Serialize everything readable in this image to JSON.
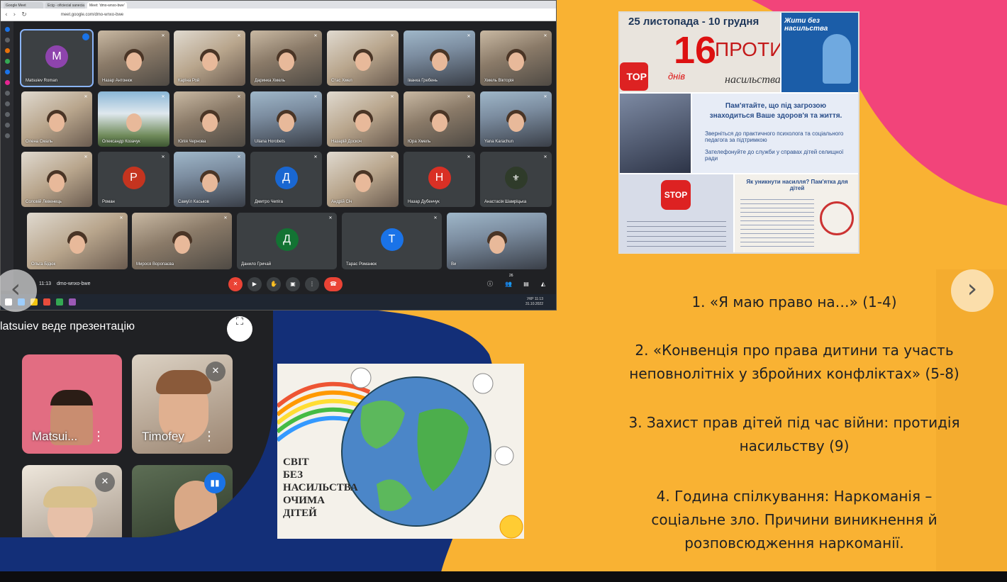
{
  "colors": {
    "orange": "#f9b233",
    "pink": "#f2447a",
    "navy": "#132f78",
    "dark": "#202124"
  },
  "browser": {
    "tabs": [
      "Google Meet",
      "Ecig - oficiecial sanecia Gr",
      "Meet: 'dmo-wnxo-bwe'"
    ],
    "url": "meet.google.com/dmo-wnxo-bwe"
  },
  "meet": {
    "participants": [
      {
        "name": "Matsuiev Roman",
        "initial": "M",
        "avatar_color": "#8e44ad"
      },
      {
        "name": "Назар Антонюк"
      },
      {
        "name": "Каріна Рой"
      },
      {
        "name": "Даринка Хмель"
      },
      {
        "name": "Стас Хмел"
      },
      {
        "name": "Іванка Гребень"
      },
      {
        "name": "Хмель Вікторія"
      },
      {
        "name": "Олена Смаль"
      },
      {
        "name": "Олександр Козачук"
      },
      {
        "name": "Юлія Чернова"
      },
      {
        "name": "Uliana Horobets"
      },
      {
        "name": "Назарій Доскоч"
      },
      {
        "name": "Юра Хмель"
      },
      {
        "name": "Yana Karachun"
      },
      {
        "name": "Соловій Левенець"
      },
      {
        "name": "Роман",
        "initial": "Р",
        "avatar_color": "#c5341f"
      },
      {
        "name": "Самуїл Каськов"
      },
      {
        "name": "Дмитро Чепіга",
        "initial": "Д",
        "avatar_color": "#1967d2"
      },
      {
        "name": "Андрій Січ"
      },
      {
        "name": "Назар Дубенчук",
        "initial": "Н",
        "avatar_color": "#d93025"
      },
      {
        "name": "Анастасія Шамріцька"
      },
      {
        "name": "Ольга Бідюк"
      },
      {
        "name": "Мирося Воропаєва"
      },
      {
        "name": "Данило Гричай",
        "initial": "Д",
        "avatar_color": "#137333"
      },
      {
        "name": "Тарас Романюк",
        "initial": "Т",
        "avatar_color": "#1a73e8"
      },
      {
        "name": "Ви"
      }
    ],
    "time": "11:13",
    "meeting_code": "dmo-wnxo-bwe",
    "participant_count": "26",
    "tray": {
      "lang": "УКР",
      "clock": "11:13",
      "date": "31.10.2022"
    }
  },
  "phone": {
    "header": "latsuiev веде презентацію",
    "tiles": [
      {
        "name": "Matsui..."
      },
      {
        "name": "Timofey"
      }
    ]
  },
  "collage": {
    "date_range": "25 листопада - 10 грудня",
    "big_number": "16",
    "title_line1": "ПРОТИ",
    "title_line2": "насильства",
    "days": "днів",
    "stop": "TOP",
    "side_title": "Жити без насильства",
    "memo_line1": "Пам'ятайте, що під загрозою",
    "memo_line2": "знаходиться Ваше здоров'я та життя.",
    "memo_b1": "Зверніться до практичного психолога та соціального педагога за підтримкою",
    "memo_b2": "Зателефонуйте до служби у справах дітей селищної ради",
    "stop_sign": "STOP",
    "howto_title": "Як уникнути насилля? Пам'ятка для дітей"
  },
  "drawing": {
    "line1": "СВІТ",
    "line2": "БЕЗ",
    "line3": "НАСИЛЬСТВА",
    "line4": "ОЧИМА",
    "line5": "ДІТЕЙ"
  },
  "agenda": [
    "1. «Я маю право на…» (1-4)",
    "2. «Конвенція про права дитини та участь",
    "неповнолітніх у збройних конфліктах» (5-8)",
    "3. Захист прав дітей під час війни: протидія",
    "насильству (9)",
    "4. Година спілкування: Наркоманія –",
    "соціальне зло. Причини виникнення й",
    "розповсюдження наркоманії."
  ],
  "nav": {
    "prev": "‹",
    "next": "›"
  }
}
